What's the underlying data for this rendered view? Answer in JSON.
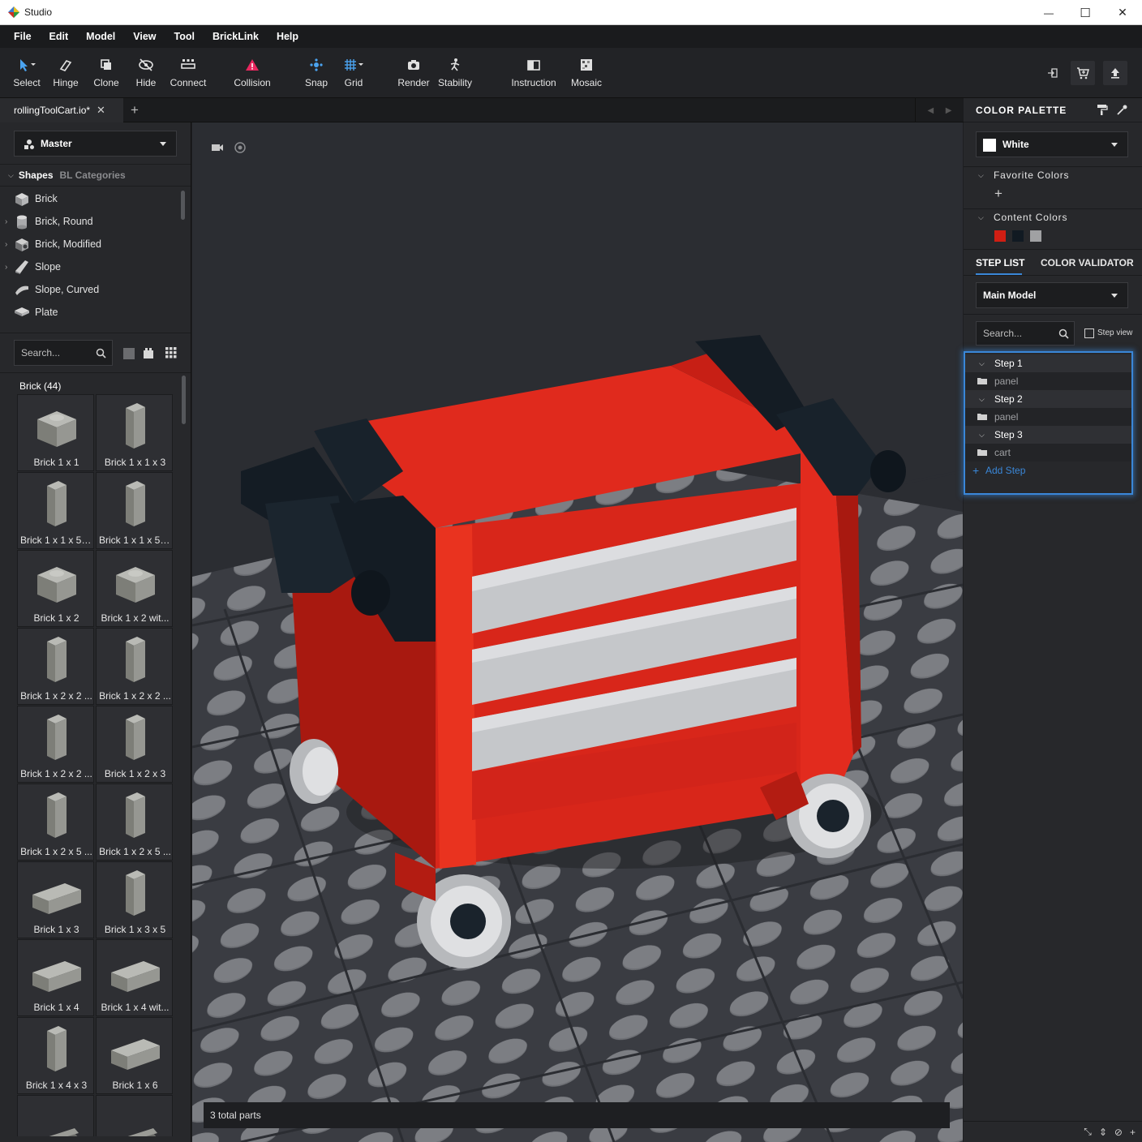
{
  "window": {
    "title": "Studio",
    "minimize": "—",
    "maximize": "☐",
    "close": "✕"
  },
  "menu": [
    "File",
    "Edit",
    "Model",
    "View",
    "Tool",
    "BrickLink",
    "Help"
  ],
  "toolbar": {
    "select": "Select",
    "hinge": "Hinge",
    "clone": "Clone",
    "hide": "Hide",
    "connect": "Connect",
    "collision": "Collision",
    "snap": "Snap",
    "grid": "Grid",
    "render": "Render",
    "stability": "Stability",
    "instruction": "Instruction",
    "mosaic": "Mosaic"
  },
  "tabs": {
    "file": "rollingToolCart.io*",
    "close": "✕",
    "new": "+"
  },
  "left": {
    "palette": "Master",
    "shapes_tab": "Shapes",
    "bl_tab": "BL Categories",
    "shapes": [
      {
        "label": "Brick",
        "expandable": false
      },
      {
        "label": "Brick, Round",
        "expandable": true
      },
      {
        "label": "Brick, Modified",
        "expandable": true
      },
      {
        "label": "Slope",
        "expandable": true
      },
      {
        "label": "Slope, Curved",
        "expandable": false
      },
      {
        "label": "Plate",
        "expandable": false
      }
    ],
    "search_placeholder": "Search...",
    "parts_header": "Brick (44)",
    "parts": [
      "Brick 1 x 1",
      "Brick 1 x 1 x 3",
      "Brick 1 x 1 x 5 -...",
      "Brick 1 x 1 x 5 -...",
      "Brick 1 x 2",
      "Brick 1 x 2 wit...",
      "Brick 1 x 2 x 2 ...",
      "Brick 1 x 2 x 2 ...",
      "Brick 1 x 2 x 2 ...",
      "Brick 1 x 2 x 3",
      "Brick 1 x 2 x 5 ...",
      "Brick 1 x 2 x 5 ...",
      "Brick 1 x 3",
      "Brick 1 x 3 x 5",
      "Brick 1 x 4",
      "Brick 1 x 4 wit...",
      "Brick 1 x 4 x 3",
      "Brick 1 x 6",
      "",
      ""
    ]
  },
  "viewport": {
    "status": "3 total parts"
  },
  "right": {
    "color_palette": "COLOR PALETTE",
    "current_color": "White",
    "favorite_colors": "Favorite Colors",
    "content_colors": "Content Colors",
    "content_swatches": [
      "#d01e13",
      "#111a22",
      "#a0a1a3"
    ],
    "tab_step_list": "STEP LIST",
    "tab_color_validator": "COLOR VALIDATOR",
    "model_select": "Main Model",
    "search_placeholder": "Search...",
    "step_view": "Step view",
    "steps": [
      {
        "label": "Step 1",
        "item": "panel"
      },
      {
        "label": "Step 2",
        "item": "panel"
      },
      {
        "label": "Step 3",
        "item": "cart"
      }
    ],
    "add_step": "Add Step"
  },
  "colors": {
    "accent": "#3a87d8",
    "brick_red": "#d8261a",
    "dark_bley": "#141c24"
  }
}
